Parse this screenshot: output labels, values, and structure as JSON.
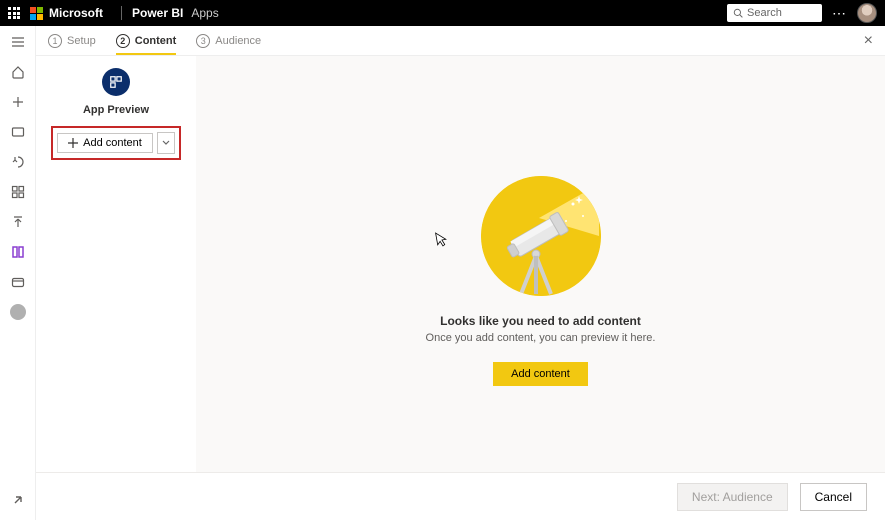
{
  "header": {
    "brand_ms": "Microsoft",
    "brand_product": "Power BI",
    "section": "Apps",
    "search_placeholder": "Search"
  },
  "wizard": {
    "steps": [
      {
        "num": "1",
        "label": "Setup"
      },
      {
        "num": "2",
        "label": "Content"
      },
      {
        "num": "3",
        "label": "Audience"
      }
    ],
    "active_index": 1
  },
  "preview": {
    "title": "App Preview",
    "add_button": "Add content"
  },
  "empty_state": {
    "title": "Looks like you need to add content",
    "subtitle": "Once you add content, you can preview it here.",
    "button": "Add content"
  },
  "footer": {
    "next": "Next: Audience",
    "cancel": "Cancel"
  }
}
